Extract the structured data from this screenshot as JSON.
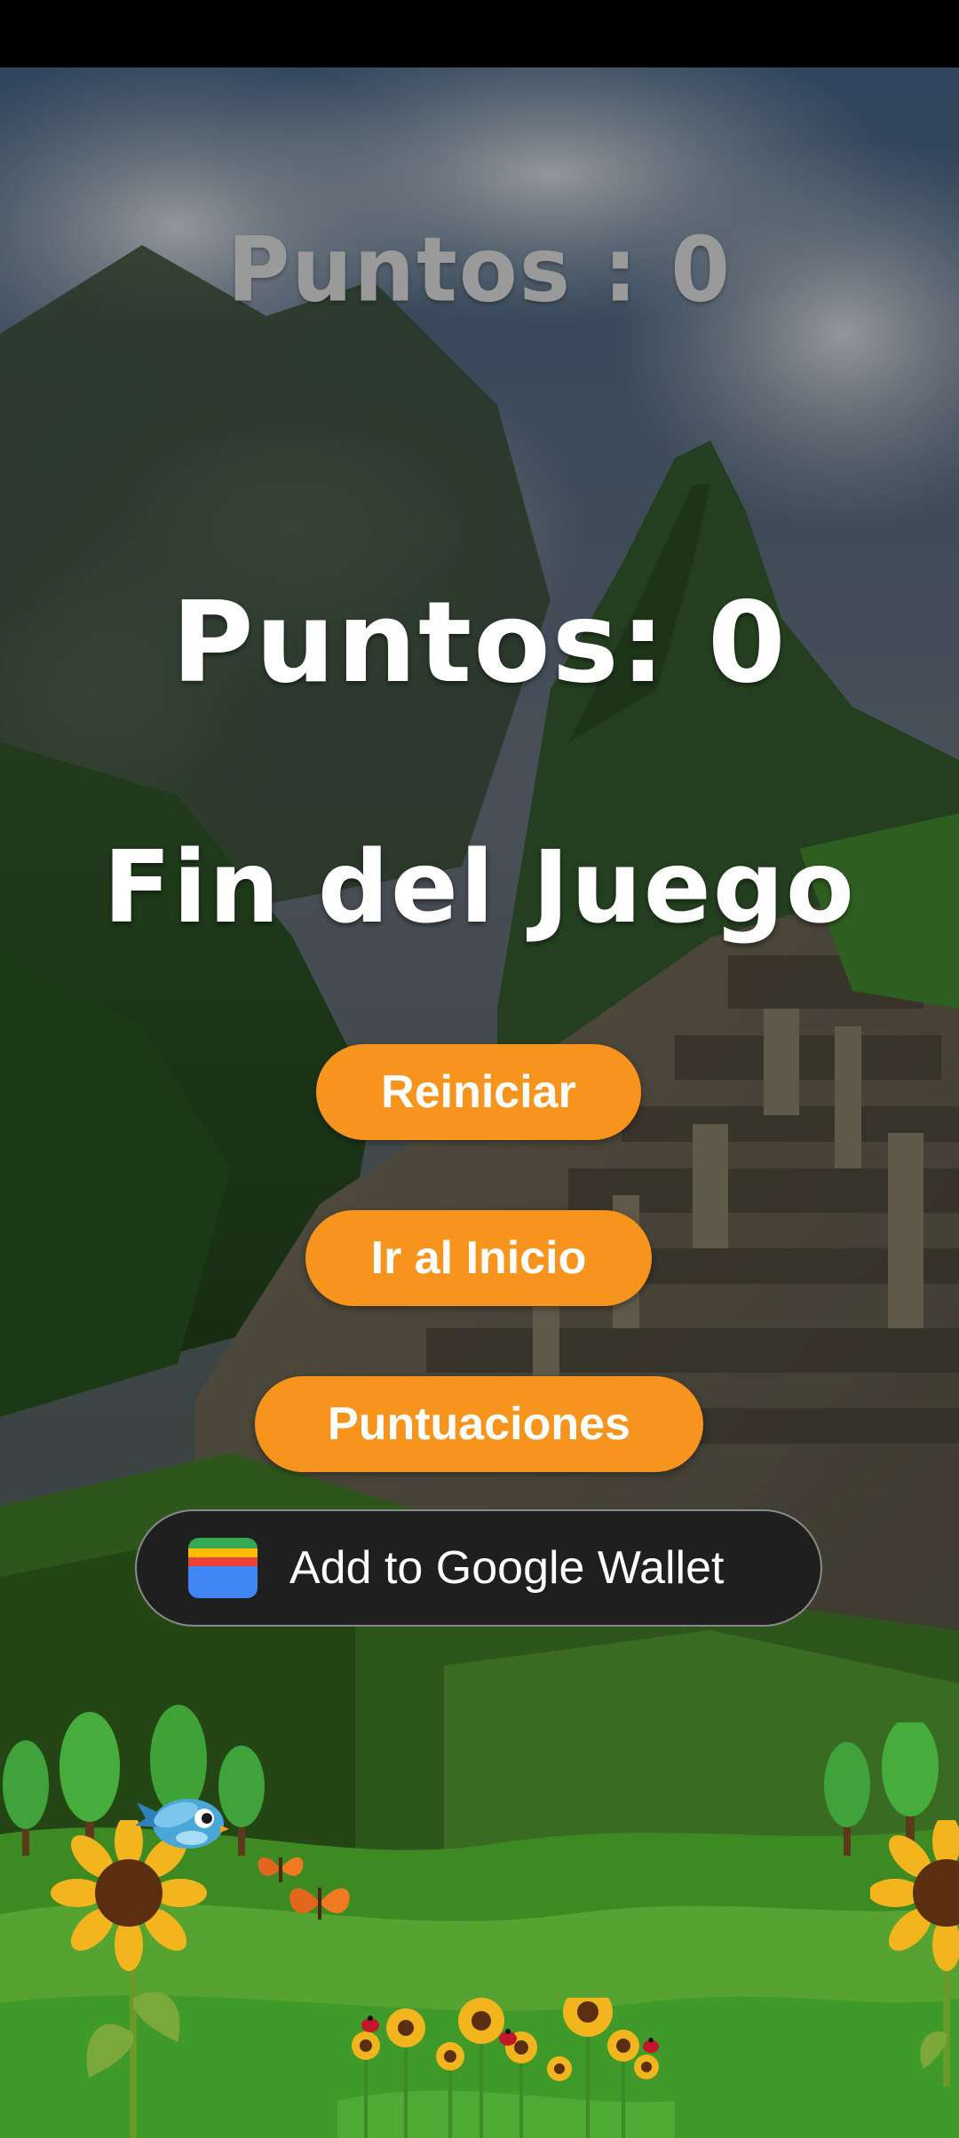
{
  "hud": {
    "score_top": "Puntos : 0"
  },
  "game_over_panel": {
    "score": "Puntos: 0",
    "title": "Fin del Juego",
    "restart_label": "Reiniciar",
    "home_label": "Ir al Inicio",
    "scores_label": "Puntuaciones",
    "wallet_label": "Add to Google Wallet"
  },
  "colors": {
    "button_orange": "#f7941d",
    "wallet_background": "#1f1f1f",
    "grass_green": "#4b9a2a"
  },
  "icons": {
    "wallet": "google-wallet-icon",
    "bird": "bird-sprite",
    "sunflower": "sunflower-decoration",
    "butterfly": "butterfly-decoration",
    "tree": "tree-decoration"
  }
}
